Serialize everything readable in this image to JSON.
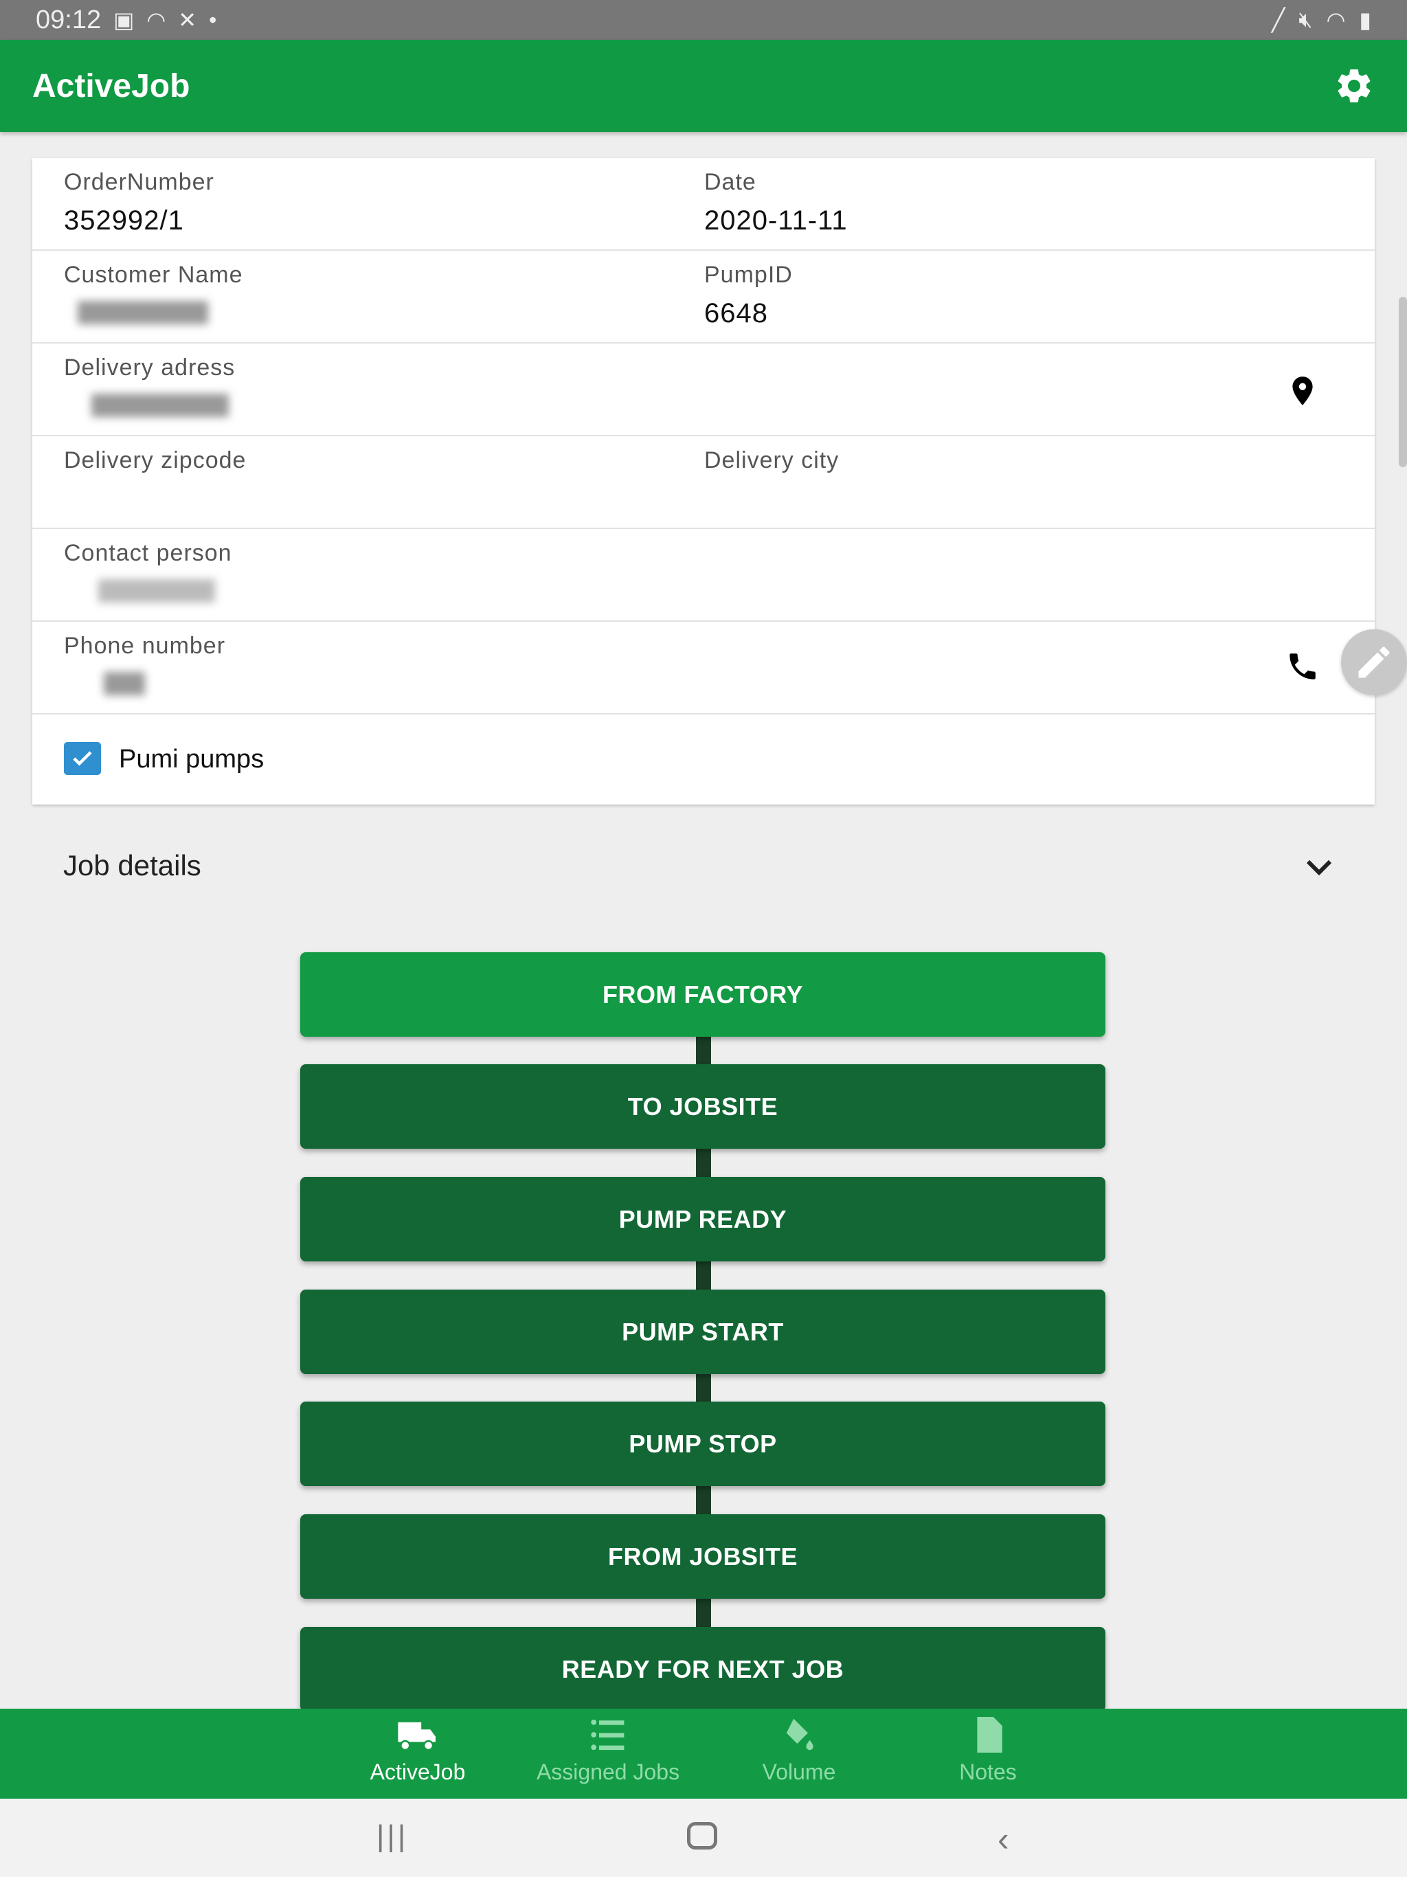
{
  "status_bar": {
    "time": "09:12"
  },
  "app_bar": {
    "title": "ActiveJob",
    "settings_icon": "gear-icon"
  },
  "order": {
    "order_number": {
      "label": "OrderNumber",
      "value": "352992/1"
    },
    "date": {
      "label": "Date",
      "value": "2020-11-11"
    },
    "customer_name": {
      "label": "Customer Name"
    },
    "pump_id": {
      "label": "PumpID",
      "value": "6648"
    },
    "delivery_address": {
      "label": "Delivery adress"
    },
    "delivery_zipcode": {
      "label": "Delivery zipcode",
      "value": ""
    },
    "delivery_city": {
      "label": "Delivery city",
      "value": ""
    },
    "contact_person": {
      "label": "Contact person"
    },
    "phone_number": {
      "label": "Phone number"
    },
    "pumi_pumps": {
      "label": "Pumi pumps",
      "checked": true
    }
  },
  "job_details": {
    "label": "Job details",
    "expanded": false
  },
  "steps": [
    {
      "label": "FROM FACTORY",
      "active": true
    },
    {
      "label": "TO JOBSITE",
      "active": false
    },
    {
      "label": "PUMP READY",
      "active": false
    },
    {
      "label": "PUMP START",
      "active": false
    },
    {
      "label": "PUMP STOP",
      "active": false
    },
    {
      "label": "FROM JOBSITE",
      "active": false
    },
    {
      "label": "READY FOR NEXT JOB",
      "active": false
    }
  ],
  "bottom_nav": [
    {
      "label": "ActiveJob",
      "icon": "truck-icon",
      "selected": true
    },
    {
      "label": "Assigned Jobs",
      "icon": "list-icon",
      "selected": false
    },
    {
      "label": "Volume",
      "icon": "paint-bucket-icon",
      "selected": false
    },
    {
      "label": "Notes",
      "icon": "note-icon",
      "selected": false
    }
  ],
  "colors": {
    "primary": "#139a44",
    "step_button": "#126735",
    "checkbox": "#2f8fcf"
  }
}
